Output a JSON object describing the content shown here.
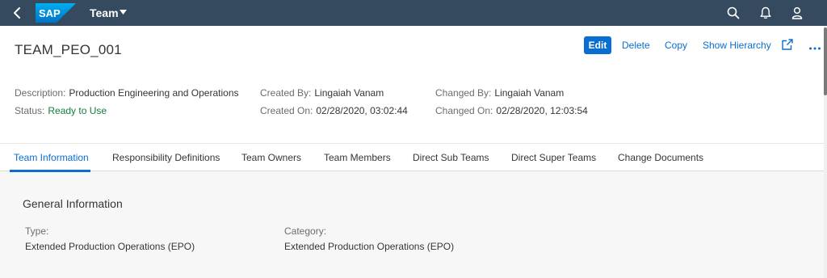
{
  "shell": {
    "logo_text": "SAP",
    "app_title": "Team",
    "icons": [
      "back-icon",
      "search-icon",
      "bell-icon",
      "user-icon"
    ],
    "brand_color": "#354a5f"
  },
  "header": {
    "title": "TEAM_PEO_001",
    "actions": {
      "edit": "Edit",
      "delete": "Delete",
      "copy": "Copy",
      "show_hierarchy": "Show Hierarchy"
    },
    "attributes": {
      "description_label": "Description:",
      "description_value": "Production Engineering and Operations",
      "status_label": "Status:",
      "status_value": "Ready to Use",
      "created_by_label": "Created By:",
      "created_by_value": "Lingaiah Vanam",
      "created_on_label": "Created On:",
      "created_on_value": "02/28/2020, 03:02:44",
      "changed_by_label": "Changed By:",
      "changed_by_value": "Lingaiah Vanam",
      "changed_on_label": "Changed On:",
      "changed_on_value": "02/28/2020, 12:03:54"
    },
    "status_color": "#107e3e"
  },
  "tabs": [
    {
      "label": "Team Information",
      "active": true
    },
    {
      "label": "Responsibility Definitions",
      "active": false
    },
    {
      "label": "Team Owners",
      "active": false
    },
    {
      "label": "Team Members",
      "active": false
    },
    {
      "label": "Direct Sub Teams",
      "active": false
    },
    {
      "label": "Direct Super Teams",
      "active": false
    },
    {
      "label": "Change Documents",
      "active": false
    }
  ],
  "content": {
    "section_title": "General Information",
    "type_label": "Type:",
    "type_value": "Extended Production Operations (EPO)",
    "category_label": "Category:",
    "category_value": "Extended Production Operations (EPO)"
  },
  "accent_color": "#0a6ed1"
}
